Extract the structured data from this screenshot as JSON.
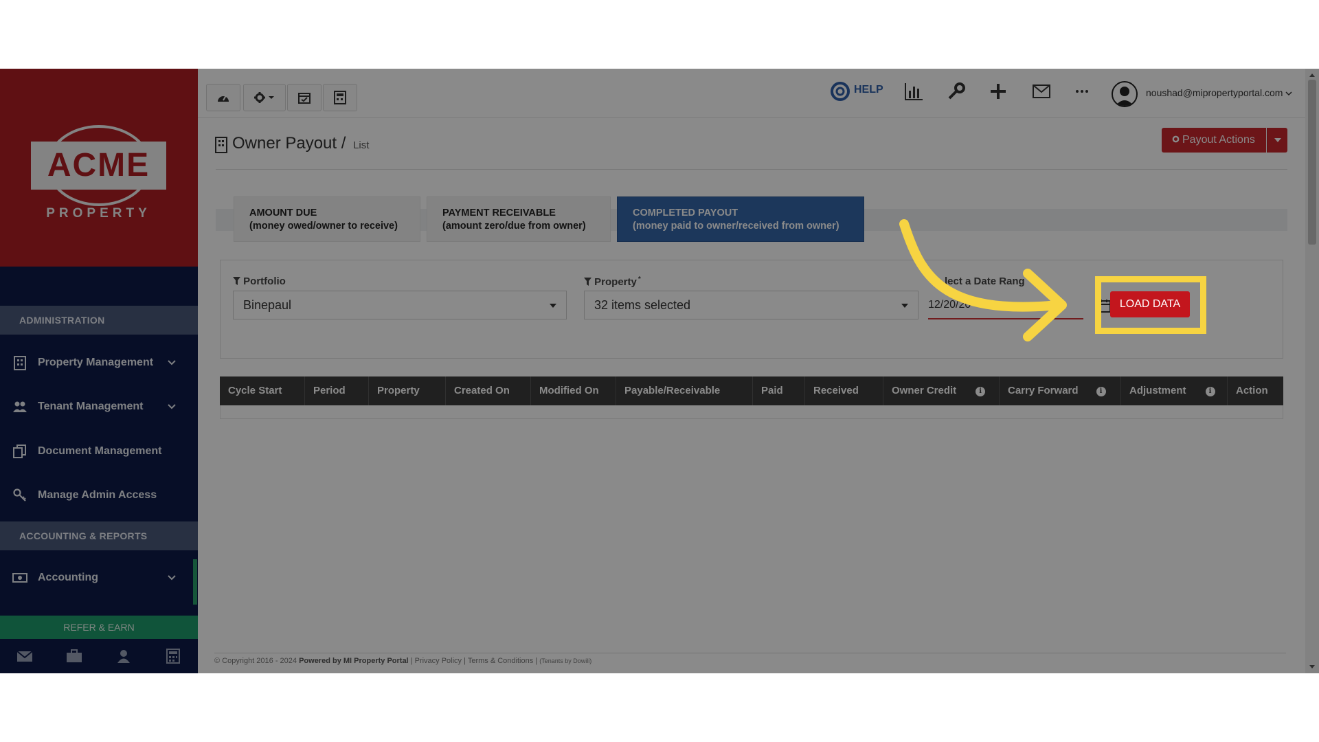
{
  "sidebar": {
    "logo_main": "ACME",
    "logo_sub": "PROPERTY",
    "section_admin": "ADMINISTRATION",
    "section_reports": "ACCOUNTING & REPORTS",
    "items": [
      {
        "label": "Property Management"
      },
      {
        "label": "Tenant Management"
      },
      {
        "label": "Document Management"
      },
      {
        "label": "Manage Admin Access"
      },
      {
        "label": "Accounting"
      }
    ],
    "refer_label": "REFER & EARN"
  },
  "topbar": {
    "help_label": "HELP",
    "user_email": "noushad@mipropertyportal.com"
  },
  "page": {
    "title": "Owner Payout /",
    "subtitle": "List",
    "payout_actions": "Payout Actions"
  },
  "tabs": [
    {
      "line1": "AMOUNT DUE",
      "line2": "(money owed/owner to receive)",
      "active": false
    },
    {
      "line1": "PAYMENT RECEIVABLE",
      "line2": "(amount zero/due from owner)",
      "active": false
    },
    {
      "line1": "COMPLETED PAYOUT",
      "line2": "(money paid to owner/received from owner)",
      "active": true
    }
  ],
  "filters": {
    "portfolio_label": "Portfolio",
    "portfolio_value": "Binepaul",
    "property_label": "Property",
    "property_required_mark": "*",
    "property_value": "32 items selected",
    "date_label": "lect a Date Rang",
    "date_value": "12/20/20",
    "load_label": "LOAD DATA"
  },
  "table": {
    "columns": [
      "Cycle Start",
      "Period",
      "Property",
      "Created On",
      "Modified On",
      "Payable/Receivable",
      "Paid",
      "Received",
      "Owner Credit",
      "Carry Forward",
      "Adjustment",
      "Action"
    ],
    "info_glyph": "i"
  },
  "footer": {
    "copyright": "© Copyright 2016 - 2024",
    "powered": "Powered by MI Property Portal",
    "links": "| Privacy Policy | Terms & Conditions |",
    "tenants": "(Tenants by Dowili)"
  },
  "colors": {
    "brand_red": "#b01e24",
    "sidebar_navy": "#0e1a48",
    "tab_active": "#3566a8",
    "highlight": "#f7d442",
    "refer_green": "#1f9c6b"
  }
}
